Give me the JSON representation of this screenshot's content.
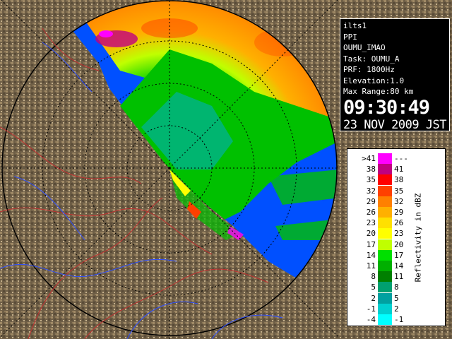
{
  "info": {
    "station": "ilts1",
    "product": "PPI",
    "site": "OUMU_IMAO",
    "task": "Task: OUMU_A",
    "prf": "PRF: 1800Hz",
    "elevation": "Elevation:1.0",
    "max_range": "Max Range:80 km",
    "time": "09:30:49",
    "date": "23 NOV 2009 JST"
  },
  "legend": {
    "title": "Reflectivity in dBZ",
    "rows": [
      {
        "lo": ">41",
        "hi": "---",
        "color": "#ff00ff"
      },
      {
        "lo": "38",
        "hi": "41",
        "color": "#c00080"
      },
      {
        "lo": "35",
        "hi": "38",
        "color": "#ff0000"
      },
      {
        "lo": "32",
        "hi": "35",
        "color": "#ff4000"
      },
      {
        "lo": "29",
        "hi": "32",
        "color": "#ff8000"
      },
      {
        "lo": "26",
        "hi": "29",
        "color": "#ffb000"
      },
      {
        "lo": "23",
        "hi": "26",
        "color": "#ffe000"
      },
      {
        "lo": "20",
        "hi": "23",
        "color": "#ffff00"
      },
      {
        "lo": "17",
        "hi": "20",
        "color": "#c0ff00"
      },
      {
        "lo": "14",
        "hi": "17",
        "color": "#00e000"
      },
      {
        "lo": "11",
        "hi": "14",
        "color": "#00b000"
      },
      {
        "lo": "8",
        "hi": "11",
        "color": "#008000"
      },
      {
        "lo": "5",
        "hi": "8",
        "color": "#00a070"
      },
      {
        "lo": "2",
        "hi": "5",
        "color": "#00a0a0"
      },
      {
        "lo": "-1",
        "hi": "2",
        "color": "#00d0d0"
      },
      {
        "lo": "-4",
        "hi": "-1",
        "color": "#00ffff"
      }
    ]
  },
  "map": {
    "sea_color": "#0050ff",
    "terrain_color": "#7a6a50",
    "range_ring_color": "#000000",
    "border_color": "#c03030",
    "river_color": "#3050ff"
  }
}
